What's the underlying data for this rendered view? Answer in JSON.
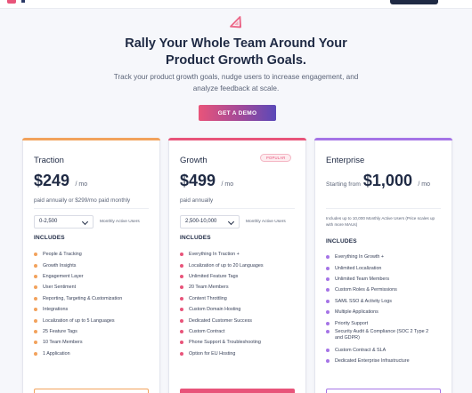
{
  "hero": {
    "headline_line1": "Rally Your Whole Team Around Your",
    "headline_line2": "Product Growth Goals.",
    "subline_line1": "Track your product growth goals, nudge users to increase engagement, and",
    "subline_line2": "analyze feedback at scale.",
    "cta_label": "GET A DEMO"
  },
  "colors": {
    "traction": "#f2a25c",
    "growth": "#e8547a",
    "enterprise": "#a574e6",
    "brand_pink": "#e8547a",
    "brand_purple": "#5a49b8",
    "navy": "#1f2a44"
  },
  "plans": {
    "traction": {
      "name": "Traction",
      "price": "$249",
      "period": "/ mo",
      "billing": "paid annually or $299/mo paid monthly",
      "users_option": "0-2,500",
      "users_label": "Monthly Active Users",
      "includes_label": "INCLUDES",
      "features": [
        "People & Tracking",
        "Growth Insights",
        "Engagement Layer",
        "User Sentiment",
        "Reporting, Targeting & Customization",
        "Integrations",
        "Localization of up to 5 Languages",
        "25 Feature Tags",
        "10 Team Members",
        "1 Application"
      ]
    },
    "growth": {
      "name": "Growth",
      "badge": "POPULAR",
      "price": "$499",
      "period": "/ mo",
      "billing": "paid annually",
      "users_option": "2,500-10,000",
      "users_label": "Monthly Active Users",
      "includes_label": "INCLUDES",
      "features": [
        "Everything In Traction +",
        "Localization of up to 20 Languages",
        "Unlimited Feature Tags",
        "20 Team Members",
        "Content Throttling",
        "Custom Domain Hosting",
        "Dedicated Customer Success",
        "Custom Contract",
        "Phone Support & Troubleshooting",
        "Option for EU Hosting"
      ]
    },
    "enterprise": {
      "name": "Enterprise",
      "price_prefix": "Starting from",
      "price": "$1,000",
      "period": "/ mo",
      "note": "Includes up to 10,000 Monthly Active Users (Price scales up with more MAUs)",
      "includes_label": "INCLUDES",
      "features": [
        "Everything In Growth +",
        "Unlimited Localization",
        "Unlimited Team Members",
        "Custom Roles & Permissions",
        "SAML SSO & Activity Logs",
        "Multiple Applications",
        "Priority Support",
        "Security Audit & Compliance (SOC 2 Type 2 and GDPR)",
        "Custom Contract & SLA",
        "Dedicated Enterprise Infrastructure"
      ]
    }
  }
}
